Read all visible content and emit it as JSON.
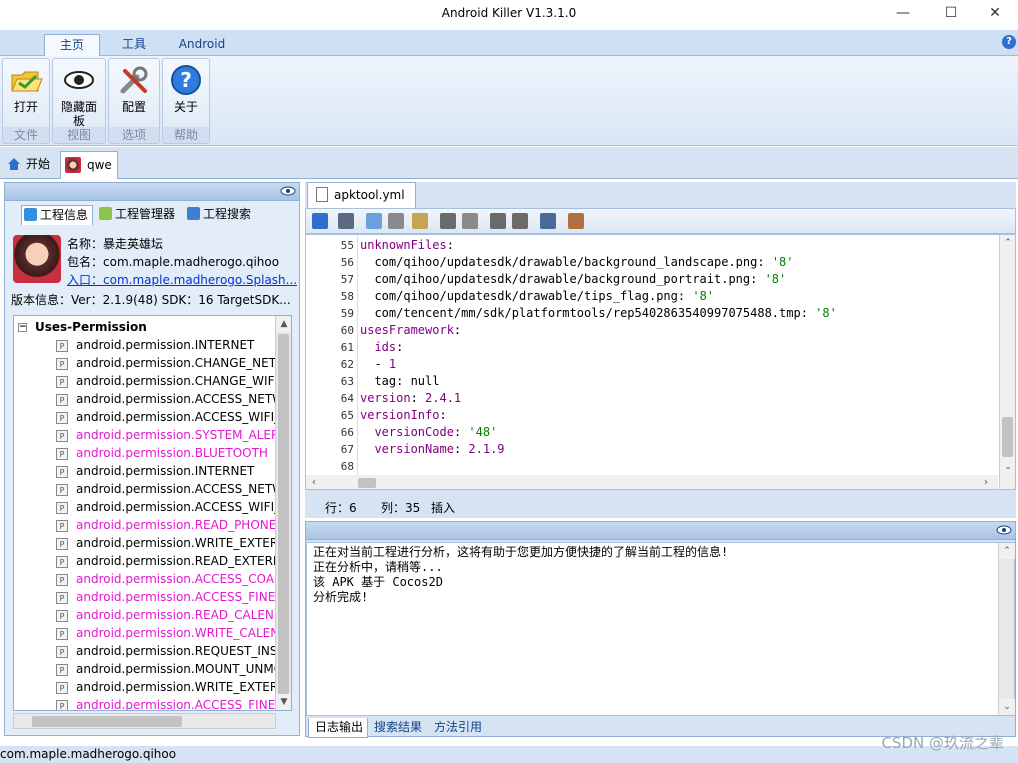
{
  "window": {
    "title": "Android Killer V1.3.1.0",
    "controls": [
      "minimize",
      "maximize",
      "close"
    ]
  },
  "ribbon": {
    "tabs": [
      {
        "label": "主页",
        "active": true
      },
      {
        "label": "工具",
        "active": false
      },
      {
        "label": "Android",
        "active": false
      }
    ],
    "groups": [
      {
        "button": "打开",
        "group": "文件",
        "icon": "folder-open-icon"
      },
      {
        "button": "隐藏面板",
        "group": "视图",
        "icon": "eye-icon"
      },
      {
        "button": "配置",
        "group": "选项",
        "icon": "wrench-icon"
      },
      {
        "button": "关于",
        "group": "帮助",
        "icon": "help-icon"
      }
    ]
  },
  "doc_tabs": [
    {
      "label": "开始",
      "icon": "home-icon"
    },
    {
      "label": "qwe",
      "icon": "app-avatar-icon",
      "active": true
    }
  ],
  "left_panel": {
    "subtabs": [
      {
        "label": "工程信息",
        "active": true
      },
      {
        "label": "工程管理器",
        "active": false
      },
      {
        "label": "工程搜索",
        "active": false
      }
    ],
    "info": {
      "name": "名称：暴走英雄坛",
      "package": "包名：com.maple.madherogo.qihoo",
      "entry_prefix": "入口：",
      "entry": "com.maple.madherogo.Splash...",
      "version": "版本信息：Ver：2.1.9(48) SDK：16 TargetSDK..."
    },
    "tree": {
      "root": "Uses-Permission",
      "items": [
        {
          "text": "android.permission.INTERNET",
          "highlight": false
        },
        {
          "text": "android.permission.CHANGE_NETWORK_STATE",
          "highlight": false
        },
        {
          "text": "android.permission.CHANGE_WIFI_STATE",
          "highlight": false
        },
        {
          "text": "android.permission.ACCESS_NETWORK_STATE",
          "highlight": false
        },
        {
          "text": "android.permission.ACCESS_WIFI_STATE",
          "highlight": false
        },
        {
          "text": "android.permission.SYSTEM_ALERT_WINDOW",
          "highlight": true
        },
        {
          "text": "android.permission.BLUETOOTH",
          "highlight": true
        },
        {
          "text": "android.permission.INTERNET",
          "highlight": false
        },
        {
          "text": "android.permission.ACCESS_NETWORK_STATE",
          "highlight": false
        },
        {
          "text": "android.permission.ACCESS_WIFI_STATE",
          "highlight": false
        },
        {
          "text": "android.permission.READ_PHONE_STATE",
          "highlight": true
        },
        {
          "text": "android.permission.WRITE_EXTERNAL_STORAGE",
          "highlight": false
        },
        {
          "text": "android.permission.READ_EXTERNAL_STORAGE",
          "highlight": false
        },
        {
          "text": "android.permission.ACCESS_COARSE_LOCATION",
          "highlight": true
        },
        {
          "text": "android.permission.ACCESS_FINE_LOCATION",
          "highlight": true
        },
        {
          "text": "android.permission.READ_CALENDAR",
          "highlight": true
        },
        {
          "text": "android.permission.WRITE_CALENDAR",
          "highlight": true
        },
        {
          "text": "android.permission.REQUEST_INSTALL_PACKAGES",
          "highlight": false
        },
        {
          "text": "android.permission.MOUNT_UNMOUNT_FILESYSTEMS",
          "highlight": false
        },
        {
          "text": "android.permission.WRITE_EXTERNAL_STORAGE",
          "highlight": false
        },
        {
          "text": "android.permission.ACCESS_FINE_LOCATION",
          "highlight": true
        }
      ]
    }
  },
  "editor": {
    "file_tab": "apktool.yml",
    "lines": [
      {
        "n": "55",
        "html": "<span class='k'>unknownFiles</span>:"
      },
      {
        "n": "56",
        "html": "  com/qihoo/updatesdk/drawable/background_landscape.png: <span class='s'>'8'</span>"
      },
      {
        "n": "57",
        "html": "  com/qihoo/updatesdk/drawable/background_portrait.png: <span class='s'>'8'</span>"
      },
      {
        "n": "58",
        "html": "  com/qihoo/updatesdk/drawable/tips_flag.png: <span class='s'>'8'</span>"
      },
      {
        "n": "59",
        "html": "  com/tencent/mm/sdk/platformtools/rep5402863540997075488.tmp: <span class='s'>'8'</span>"
      },
      {
        "n": "60",
        "html": "<span class='k'>usesFramework</span>:"
      },
      {
        "n": "61",
        "html": "  <span class='k'>ids</span>:"
      },
      {
        "n": "62",
        "html": "  - <span class='n'>1</span>"
      },
      {
        "n": "63",
        "html": "  tag: null"
      },
      {
        "n": "64",
        "html": "<span class='k'>version</span>: <span class='n'>2.4.1</span>"
      },
      {
        "n": "65",
        "html": "<span class='k'>versionInfo</span>:"
      },
      {
        "n": "66",
        "html": "  <span class='k'>versionCode</span>: <span class='s'>'48'</span>"
      },
      {
        "n": "67",
        "html": "  <span class='k'>versionName</span>: <span class='n'>2.1.9</span>"
      },
      {
        "n": "68",
        "html": ""
      }
    ],
    "status": {
      "row": "行：6",
      "col": "列：35",
      "mode": "插入"
    }
  },
  "log": {
    "lines": [
      "正在对当前工程进行分析，这将有助于您更加方便快捷的了解当前工程的信息!",
      "正在分析中，请稍等...",
      "该 APK 基于 Cocos2D",
      "分析完成!"
    ],
    "tabs": [
      {
        "label": "日志输出",
        "active": true
      },
      {
        "label": "搜索结果",
        "active": false
      },
      {
        "label": "方法引用",
        "active": false
      }
    ]
  },
  "bottom_status": "com.maple.madherogo.qihoo",
  "watermark": "CSDN @玖流之辈",
  "colors": {
    "accent": "#15428b",
    "permission_highlight": "#e01ad0",
    "yaml_key": "#800080",
    "yaml_string": "#008000"
  }
}
